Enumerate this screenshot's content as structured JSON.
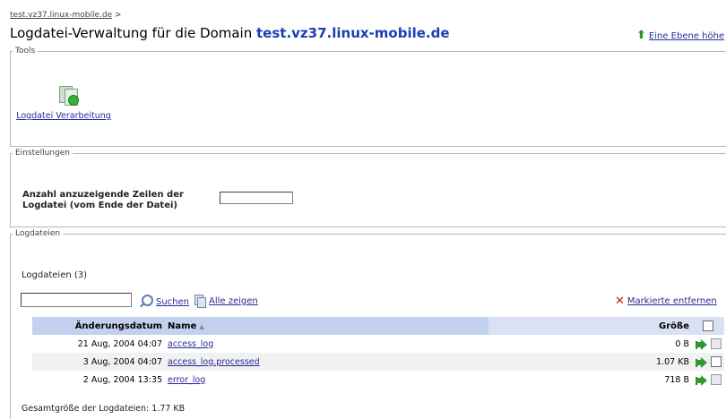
{
  "breadcrumb": "test.vz37.linux-mobile.de",
  "breadcrumb_sep": ">",
  "title": {
    "prefix": "Logdatei-Verwaltung für die Domain ",
    "domain": "test.vz37.linux-mobile.de"
  },
  "up_link": "Eine Ebene höhe",
  "colors": {
    "link": "#2a2a9a",
    "domain": "#1b3fb3",
    "header": "#c4d0ef",
    "up_arrow": "#1f9b2b",
    "remove_x": "#d11a1a"
  },
  "tools": {
    "legend": "Tools",
    "items": [
      {
        "label": "Logdatei Verarbeitung",
        "icon": "log-processing-icon"
      }
    ]
  },
  "settings": {
    "legend": "Einstellungen",
    "lines_label_1": "Anzahl anzuzeigende Zeilen der",
    "lines_label_2": "Logdatei (vom Ende der Datei)",
    "lines_value": ""
  },
  "logs": {
    "legend": "Logdateien",
    "count_label": "Logdateien (3)",
    "search_value": "",
    "search_label": "Suchen",
    "show_all_label": "Alle zeigen",
    "remove_label": "Markierte entfernen",
    "columns": {
      "date": "Änderungsdatum",
      "name": "Name",
      "size": "Größe"
    },
    "sort_indicator": "▲",
    "rows": [
      {
        "date": "21 Aug, 2004 04:07",
        "name": "access_log",
        "size": "0 B"
      },
      {
        "date": "3 Aug, 2004 04:07",
        "name": "access_log.processed",
        "size": "1.07 KB"
      },
      {
        "date": "2 Aug, 2004 13:35",
        "name": "error_log",
        "size": "718 B"
      }
    ],
    "total_label": "Gesamtgröße der Logdateien: 1.77 KB"
  }
}
